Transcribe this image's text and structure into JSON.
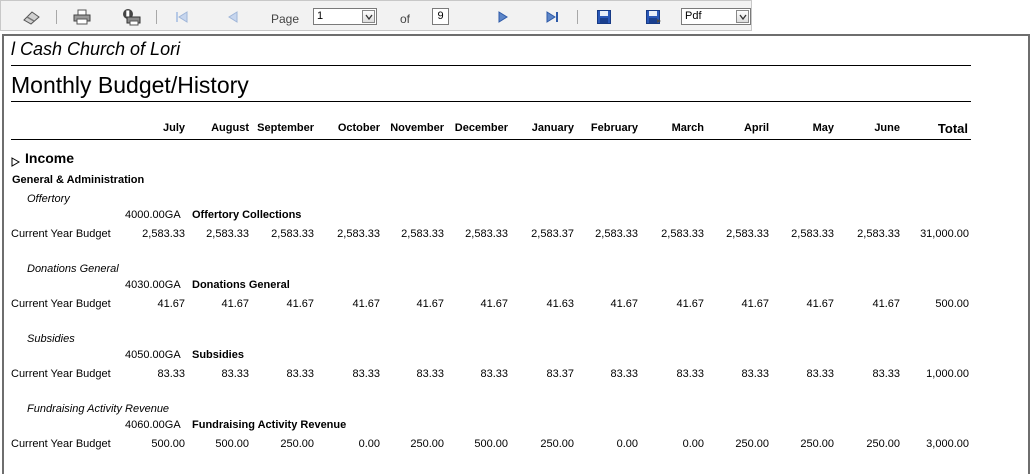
{
  "toolbar": {
    "page_label": "Page",
    "page_value": "1",
    "of_label": "of",
    "total_pages": "9",
    "export_format": "Pdf"
  },
  "report": {
    "org_name": "l Cash Church of Lori",
    "title": "Monthly Budget/History",
    "columns": [
      "July",
      "August",
      "September",
      "October",
      "November",
      "December",
      "January",
      "February",
      "March",
      "April",
      "May",
      "June"
    ],
    "total_label": "Total",
    "section": {
      "name": "Income",
      "group": "General & Administration",
      "accounts": [
        {
          "label": "Offertory",
          "code": "4000.00GA",
          "description": "Offertory Collections",
          "row_label": "Current Year Budget",
          "values": [
            "2,583.33",
            "2,583.33",
            "2,583.33",
            "2,583.33",
            "2,583.33",
            "2,583.33",
            "2,583.37",
            "2,583.33",
            "2,583.33",
            "2,583.33",
            "2,583.33",
            "2,583.33"
          ],
          "total": "31,000.00"
        },
        {
          "label": "Donations  General",
          "code": "4030.00GA",
          "description": "Donations  General",
          "row_label": "Current Year Budget",
          "values": [
            "41.67",
            "41.67",
            "41.67",
            "41.67",
            "41.67",
            "41.67",
            "41.63",
            "41.67",
            "41.67",
            "41.67",
            "41.67",
            "41.67"
          ],
          "total": "500.00"
        },
        {
          "label": "Subsidies",
          "code": "4050.00GA",
          "description": "Subsidies",
          "row_label": "Current Year Budget",
          "values": [
            "83.33",
            "83.33",
            "83.33",
            "83.33",
            "83.33",
            "83.33",
            "83.37",
            "83.33",
            "83.33",
            "83.33",
            "83.33",
            "83.33"
          ],
          "total": "1,000.00"
        },
        {
          "label": "Fundraising Activity Revenue",
          "code": "4060.00GA",
          "description": "Fundraising Activity Revenue",
          "row_label": "Current Year Budget",
          "values": [
            "500.00",
            "500.00",
            "250.00",
            "0.00",
            "250.00",
            "500.00",
            "250.00",
            "0.00",
            "0.00",
            "250.00",
            "250.00",
            "250.00"
          ],
          "total": "3,000.00"
        }
      ]
    }
  },
  "icons": [
    "eraser-icon",
    "print-icon",
    "print-setup-icon",
    "first-page-icon",
    "previous-page-icon",
    "next-page-icon",
    "last-page-icon",
    "save-icon",
    "export-icon",
    "chevron-down-icon",
    "expand-triangle-icon"
  ]
}
